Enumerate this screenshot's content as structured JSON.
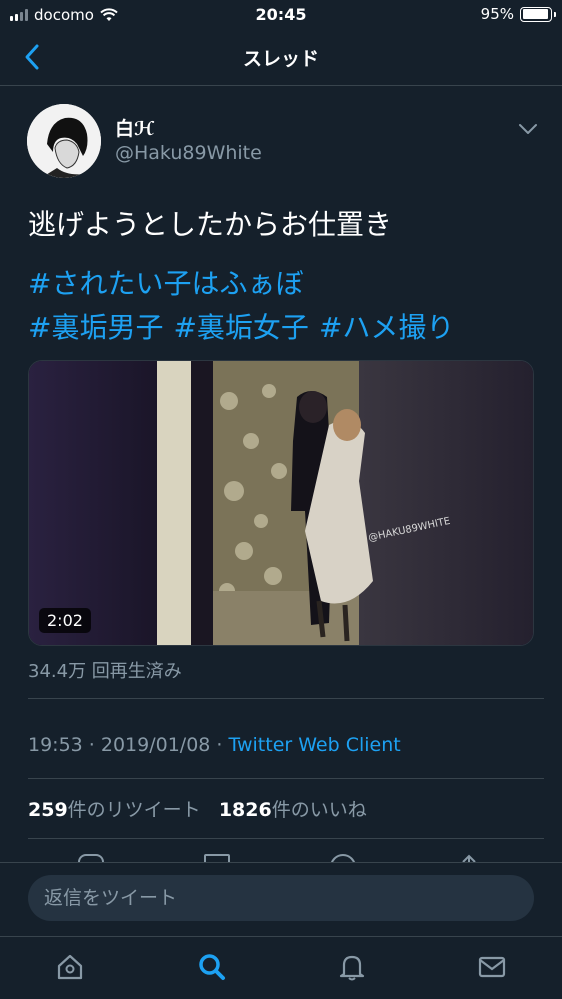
{
  "status_bar": {
    "carrier": "docomo",
    "time": "20:45",
    "battery_percent": "95%",
    "battery_level": 0.95,
    "signal_bars": 2
  },
  "nav": {
    "title": "スレッド",
    "back_icon": "chevron-left-icon"
  },
  "tweet": {
    "display_name": "白ℋ",
    "handle": "@Haku89White",
    "text": "逃げようとしたからお仕置き",
    "hashtags": [
      "#されたい子はふぁぼ",
      "#裏垢男子",
      "#裏垢女子",
      "#ハメ撮り"
    ],
    "media": {
      "duration": "2:02",
      "watermark": "@HAKU89WHITE"
    },
    "views": "34.4万 回再生済み",
    "timestamp": "19:53 · 2019/01/08 · ",
    "client": "Twitter Web Client",
    "retweets_count": "259",
    "retweets_label": "件のリツイート",
    "likes_count": "1826",
    "likes_label": "件のいいね"
  },
  "reply": {
    "placeholder": "返信をツイート"
  },
  "colors": {
    "background": "#15202b",
    "accent": "#1da1f2",
    "secondary_text": "#8899a6",
    "divider": "#38444d"
  },
  "tabbar": {
    "items": [
      "home-icon",
      "search-icon",
      "notifications-icon",
      "messages-icon"
    ],
    "active": "search-icon"
  }
}
